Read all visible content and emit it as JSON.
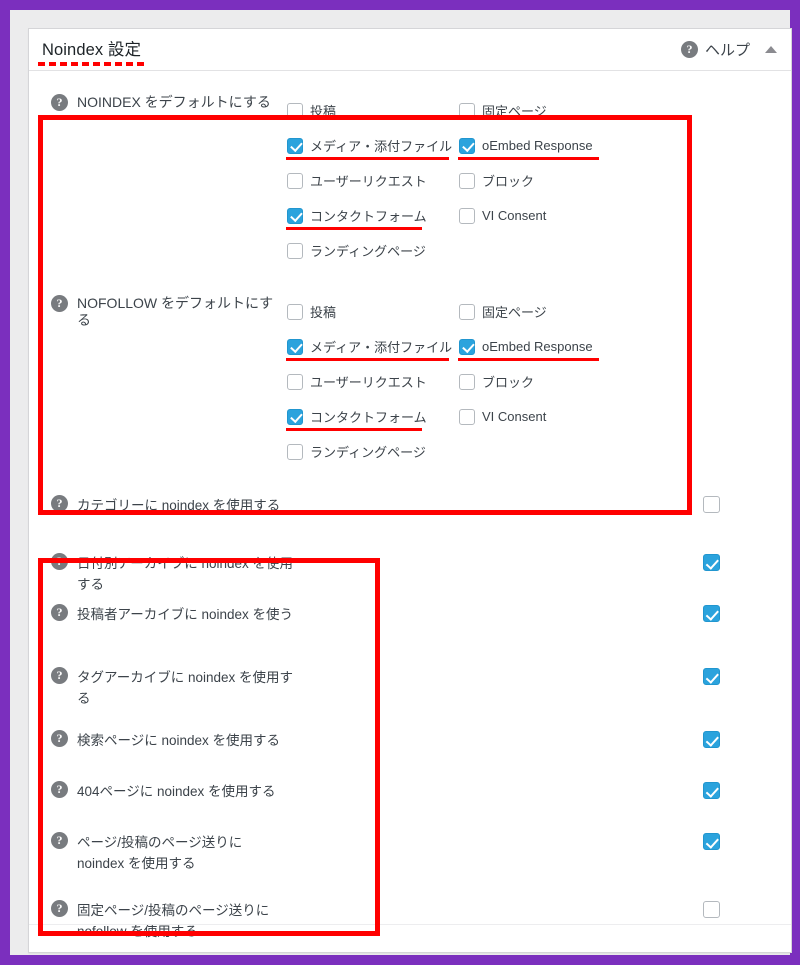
{
  "window": {
    "accent_purple": "#7b2fbe",
    "annotation_red": "#ff0000",
    "checkbox_blue": "#2ba3dd"
  },
  "panel": {
    "title": "Noindex 設定",
    "help_label": "ヘルプ",
    "help_icon": "help-circle-icon",
    "toggle_icon": "chevron-up-icon"
  },
  "default_groups": [
    {
      "name": "noindex-defaults",
      "label": "NOINDEX をデフォルトにする",
      "columns": [
        {
          "options": [
            {
              "label": "投稿",
              "checked": false,
              "highlighted": false
            },
            {
              "label": "メディア・添付ファイル",
              "checked": true,
              "highlighted": true
            },
            {
              "label": "ユーザーリクエスト",
              "checked": false,
              "highlighted": false
            },
            {
              "label": "コンタクトフォーム",
              "checked": true,
              "highlighted": true
            },
            {
              "label": "ランディングページ",
              "checked": false,
              "highlighted": false
            }
          ]
        },
        {
          "options": [
            {
              "label": "固定ページ",
              "checked": false,
              "highlighted": false
            },
            {
              "label": "oEmbed Response",
              "checked": true,
              "highlighted": true
            },
            {
              "label": "ブロック",
              "checked": false,
              "highlighted": false
            },
            {
              "label": "VI Consent",
              "checked": false,
              "highlighted": false
            }
          ]
        }
      ]
    },
    {
      "name": "nofollow-defaults",
      "label": "NOFOLLOW をデフォルトにする",
      "columns": [
        {
          "options": [
            {
              "label": "投稿",
              "checked": false,
              "highlighted": false
            },
            {
              "label": "メディア・添付ファイル",
              "checked": true,
              "highlighted": true
            },
            {
              "label": "ユーザーリクエスト",
              "checked": false,
              "highlighted": false
            },
            {
              "label": "コンタクトフォーム",
              "checked": true,
              "highlighted": true
            },
            {
              "label": "ランディングページ",
              "checked": false,
              "highlighted": false
            }
          ]
        },
        {
          "options": [
            {
              "label": "固定ページ",
              "checked": false,
              "highlighted": false
            },
            {
              "label": "oEmbed Response",
              "checked": true,
              "highlighted": true
            },
            {
              "label": "ブロック",
              "checked": false,
              "highlighted": false
            },
            {
              "label": "VI Consent",
              "checked": false,
              "highlighted": false
            }
          ]
        }
      ]
    }
  ],
  "archive_options": [
    {
      "name": "category-noindex",
      "label": "カテゴリーに noindex を使用する",
      "checked": false
    },
    {
      "name": "date-archive-noindex",
      "label": "日付別アーカイブに noindex を使用する",
      "checked": true
    },
    {
      "name": "author-archive-noindex",
      "label": "投稿者アーカイブに noindex を使う",
      "checked": true
    },
    {
      "name": "tag-archive-noindex",
      "label": "タグアーカイブに noindex を使用する",
      "checked": true
    },
    {
      "name": "search-page-noindex",
      "label": "検索ページに noindex を使用する",
      "checked": true
    },
    {
      "name": "404-page-noindex",
      "label": "404ページに noindex を使用する",
      "checked": true
    },
    {
      "name": "pagination-noindex",
      "label": "ページ/投稿のページ送りに noindex を使用する",
      "checked": true
    },
    {
      "name": "pagination-nofollow",
      "label": "固定ページ/投稿のページ送りに nofollow を使用する",
      "checked": false
    }
  ]
}
